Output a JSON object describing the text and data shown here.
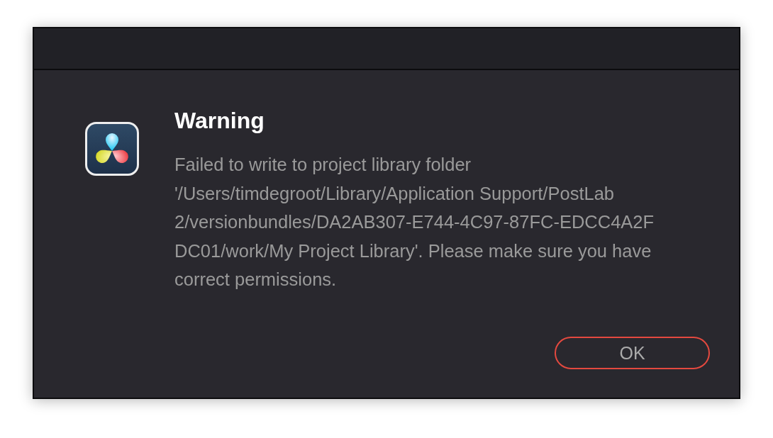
{
  "dialog": {
    "title": "Warning",
    "message": "Failed to write to project library folder\n'/Users/timdegroot/Library/Application Support/PostLab\n2/versionbundles/DA2AB307-E744-4C97-87FC-EDCC4A2F\nDC01/work/My Project Library'. Please make sure you have\ncorrect permissions.",
    "buttons": [
      {
        "label": "OK",
        "default": true
      }
    ]
  }
}
